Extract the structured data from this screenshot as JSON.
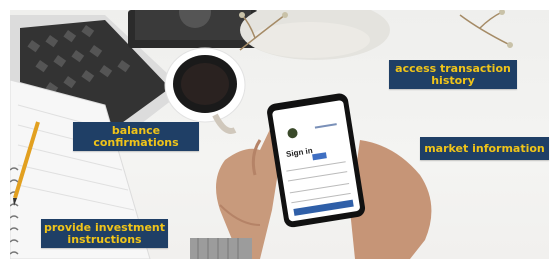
{
  "labels": {
    "balance": "balance confirmations",
    "transactions": "access transaction history",
    "market": "market information",
    "instructions": "provide investment instructions"
  },
  "phone_screen": {
    "sign_in": "Sign in"
  },
  "colors": {
    "label_background": "#1f3f66",
    "label_text": "#f0c419"
  }
}
